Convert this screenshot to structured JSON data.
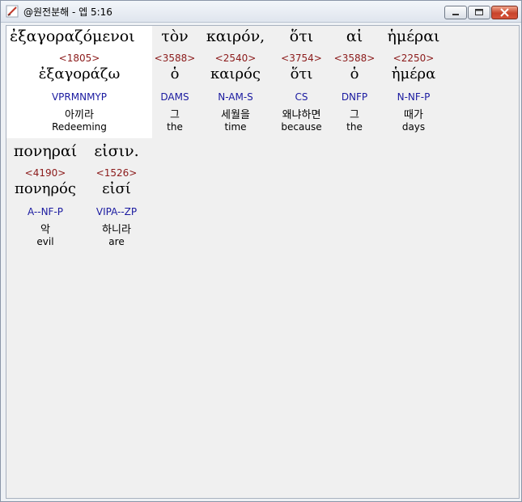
{
  "window": {
    "title": "@원전분해 - 엡 5:16",
    "icon": "pen-icon",
    "buttons": [
      "minimize-icon",
      "maximize-icon",
      "close-icon"
    ]
  },
  "words": [
    {
      "greek": "ἐξαγοραζόμενοι",
      "strong": "<1805>",
      "lemma": "ἐξαγοράζω",
      "morph": "VPRMNMYP",
      "korean": "아끼라",
      "english": "Redeeming"
    },
    {
      "greek": "τὸν",
      "strong": "<3588>",
      "lemma": "ὁ",
      "morph": "DAMS",
      "korean": "그",
      "english": "the"
    },
    {
      "greek": "καιρόν,",
      "strong": "<2540>",
      "lemma": "καιρός",
      "morph": "N-AM-S",
      "korean": "세월을",
      "english": "time"
    },
    {
      "greek": "ὅτι",
      "strong": "<3754>",
      "lemma": "ὅτι",
      "morph": "CS",
      "korean": "왜냐하면",
      "english": "because"
    },
    {
      "greek": "αἱ",
      "strong": "<3588>",
      "lemma": "ὁ",
      "morph": "DNFP",
      "korean": "그",
      "english": "the"
    },
    {
      "greek": "ἡμέραι",
      "strong": "<2250>",
      "lemma": "ἡμέρα",
      "morph": "N-NF-P",
      "korean": "때가",
      "english": "days"
    },
    {
      "greek": "πονηραί",
      "strong": "<4190>",
      "lemma": "πονηρός",
      "morph": "A--NF-P",
      "korean": "악",
      "english": "evil"
    },
    {
      "greek": "εἰσιν.",
      "strong": "<1526>",
      "lemma": "εἰσί",
      "morph": "VIPA--ZP",
      "korean": "하니라",
      "english": "are"
    }
  ]
}
